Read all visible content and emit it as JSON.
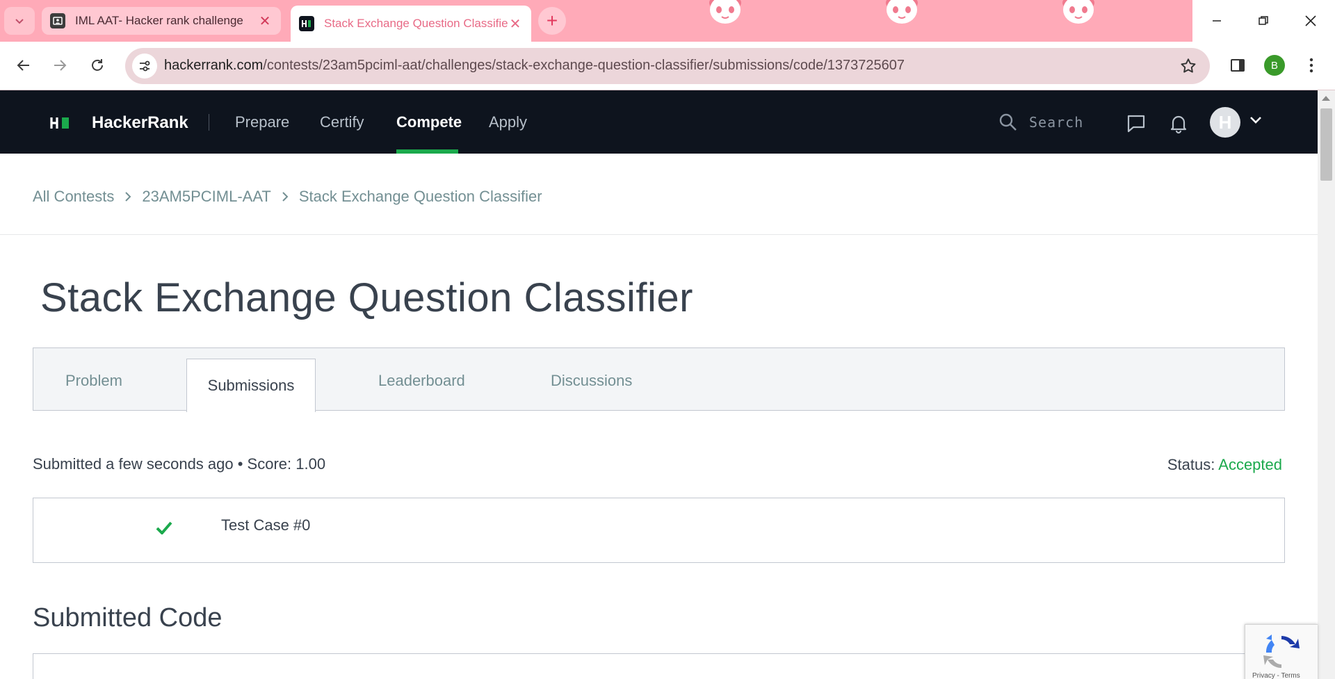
{
  "browser": {
    "tabs": [
      {
        "title": "IML AAT- Hacker rank challenge",
        "active": false
      },
      {
        "title": "Stack Exchange Question Classifier",
        "active": true
      }
    ],
    "url_host": "hackerrank.com",
    "url_path": "/contests/23am5pciml-aat/challenges/stack-exchange-question-classifier/submissions/code/1373725607",
    "profile_initial": "B"
  },
  "navbar": {
    "brand": "HackerRank",
    "links": [
      "Prepare",
      "Certify",
      "Compete",
      "Apply"
    ],
    "active_link": "Compete",
    "search_placeholder": "Search",
    "avatar_initial": "H"
  },
  "breadcrumb": [
    "All Contests",
    "23AM5PCIML-AAT",
    "Stack Exchange Question Classifier"
  ],
  "page": {
    "title": "Stack Exchange Question Classifier",
    "tabs": [
      "Problem",
      "Submissions",
      "Leaderboard",
      "Discussions"
    ],
    "active_tab": "Submissions"
  },
  "submission": {
    "info": "Submitted a few seconds ago • Score: 1.00",
    "status_label": "Status:",
    "status_value": "Accepted",
    "test_cases": [
      {
        "label": "Test Case #0",
        "passed": true
      }
    ]
  },
  "code_section": {
    "title": "Submitted Code"
  },
  "recaptcha": {
    "text": "Privacy - Terms"
  },
  "colors": {
    "accent_green": "#1ba94c",
    "nav_bg": "#0e141e",
    "tabstrip_bg": "#ffaab8"
  }
}
